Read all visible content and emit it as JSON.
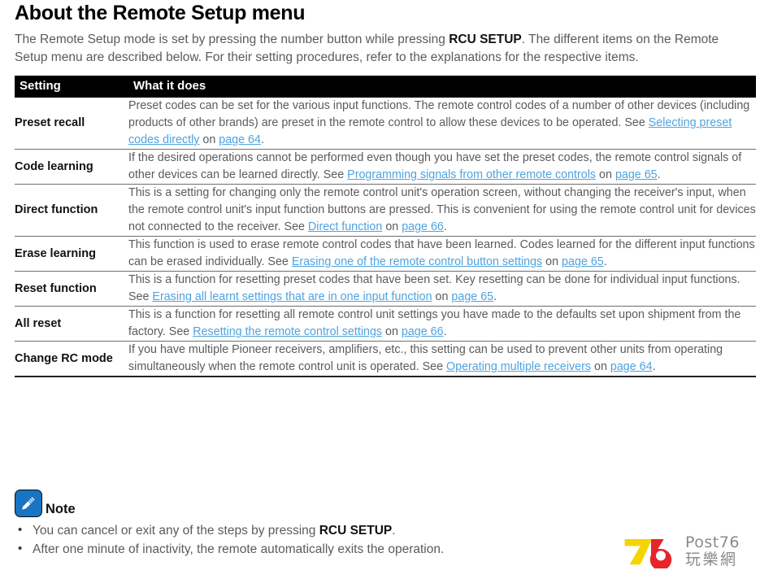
{
  "page": {
    "title": "About the Remote Setup menu",
    "intro_parts": [
      {
        "text": "The Remote Setup mode is set by pressing the number button while pressing ",
        "bold": false
      },
      {
        "text": "RCU SETUP",
        "bold": true
      },
      {
        "text": ". The different items on the Remote Setup menu are described below. For their setting procedures, refer to the explanations for the respective items.",
        "bold": false
      }
    ]
  },
  "table": {
    "headers": {
      "setting": "Setting",
      "what_it_does": "What it does"
    },
    "rows": [
      {
        "setting": "Preset recall",
        "parts": [
          {
            "text": "Preset codes can be set for the various input functions. The remote control codes of a number of other devices (including products of other brands) are preset in the remote control to allow these devices to be operated. See ",
            "link": false
          },
          {
            "text": "Selecting preset codes directly",
            "link": true
          },
          {
            "text": " on ",
            "link": false
          },
          {
            "text": "page 64",
            "link": true
          },
          {
            "text": ".",
            "link": false
          }
        ]
      },
      {
        "setting": "Code learning",
        "parts": [
          {
            "text": "If the desired operations cannot be performed even though you have set the preset codes, the remote control signals of other devices can be learned directly. See ",
            "link": false
          },
          {
            "text": "Programming signals from other remote controls",
            "link": true
          },
          {
            "text": " on ",
            "link": false
          },
          {
            "text": "page 65",
            "link": true
          },
          {
            "text": ".",
            "link": false
          }
        ]
      },
      {
        "setting": "Direct function",
        "parts": [
          {
            "text": "This is a setting for changing only the remote control unit's operation screen, without changing the receiver's input, when the remote control unit's input function buttons are pressed. This is convenient for using the remote control unit for devices not connected to the receiver. See ",
            "link": false
          },
          {
            "text": "Direct function",
            "link": true
          },
          {
            "text": " on ",
            "link": false
          },
          {
            "text": "page 66",
            "link": true
          },
          {
            "text": ".",
            "link": false
          }
        ]
      },
      {
        "setting": "Erase learning",
        "parts": [
          {
            "text": "This function is used to erase remote control codes that have been learned. Codes learned for the different input functions can be erased individually. See ",
            "link": false
          },
          {
            "text": "Erasing one of the remote control button settings",
            "link": true
          },
          {
            "text": " on ",
            "link": false
          },
          {
            "text": "page 65",
            "link": true
          },
          {
            "text": ".",
            "link": false
          }
        ]
      },
      {
        "setting": "Reset function",
        "parts": [
          {
            "text": "This is a function for resetting preset codes that have been set. Key resetting can be done for individual input functions. See ",
            "link": false
          },
          {
            "text": "Erasing all learnt settings that are in one input function",
            "link": true
          },
          {
            "text": " on ",
            "link": false
          },
          {
            "text": "page 65",
            "link": true
          },
          {
            "text": ".",
            "link": false
          }
        ]
      },
      {
        "setting": "All reset",
        "parts": [
          {
            "text": "This is a function for resetting all remote control unit settings you have made to the defaults set upon shipment from the factory. See ",
            "link": false
          },
          {
            "text": "Resetting the remote control settings",
            "link": true
          },
          {
            "text": " on ",
            "link": false
          },
          {
            "text": "page 66",
            "link": true
          },
          {
            "text": ".",
            "link": false
          }
        ]
      },
      {
        "setting": "Change RC mode",
        "parts": [
          {
            "text": "If you have multiple Pioneer receivers, amplifiers, etc., this setting can be used to prevent other units from operating simultaneously when the remote control unit is operated. See ",
            "link": false
          },
          {
            "text": "Operating multiple receivers",
            "link": true
          },
          {
            "text": " on ",
            "link": false
          },
          {
            "text": "page 64",
            "link": true
          },
          {
            "text": ".",
            "link": false
          }
        ]
      }
    ]
  },
  "note": {
    "icon_name": "pencil-note-icon",
    "label": "Note",
    "items": [
      [
        {
          "text": "You can cancel or exit any of the steps by pressing ",
          "bold": false
        },
        {
          "text": "RCU SETUP",
          "bold": true
        },
        {
          "text": ".",
          "bold": false
        }
      ],
      [
        {
          "text": "After one minute of inactivity, the remote automatically exits the operation.",
          "bold": false
        }
      ]
    ]
  },
  "watermark": {
    "mark_name": "post76-76-logo",
    "text_top": "Post76",
    "text_bottom": "玩樂網",
    "colors": {
      "yellow": "#f5d400",
      "red": "#e8232a",
      "gray": "#8a8a8a"
    }
  },
  "colors": {
    "link": "#4ea3e0",
    "header_bg": "#000000",
    "body_text": "#5b5b5b",
    "note_icon_bg": "#1a74c4"
  }
}
